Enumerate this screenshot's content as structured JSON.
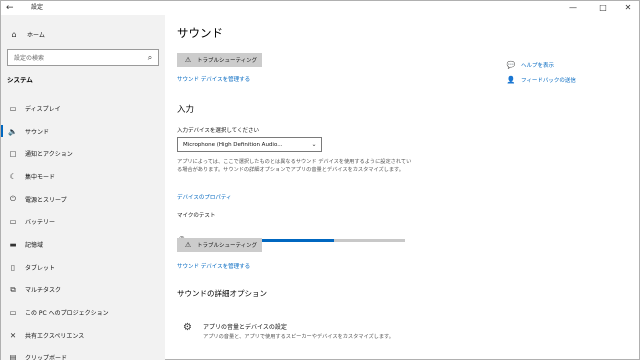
{
  "window": {
    "title": "設定",
    "back_icon": "back-arrow-icon",
    "controls": [
      "—",
      "□",
      "✕"
    ]
  },
  "sidebar": {
    "home_label": "ホーム",
    "search_placeholder": "設定の検索",
    "section": "システム",
    "items": [
      {
        "label": "ディスプレイ",
        "icon": "display-icon",
        "glyph": "▭"
      },
      {
        "label": "サウンド",
        "icon": "speaker-icon",
        "glyph": "🔈",
        "active": true
      },
      {
        "label": "通知とアクション",
        "icon": "notification-icon",
        "glyph": "▢"
      },
      {
        "label": "集中モード",
        "icon": "moon-icon",
        "glyph": "☾"
      },
      {
        "label": "電源とスリープ",
        "icon": "power-icon",
        "glyph": "⏻"
      },
      {
        "label": "バッテリー",
        "icon": "battery-icon",
        "glyph": "▭"
      },
      {
        "label": "記憶域",
        "icon": "storage-icon",
        "glyph": "▬"
      },
      {
        "label": "タブレット",
        "icon": "tablet-icon",
        "glyph": "▯"
      },
      {
        "label": "マルチタスク",
        "icon": "multitask-icon",
        "glyph": "⧉"
      },
      {
        "label": "この PC へのプロジェクション",
        "icon": "projection-icon",
        "glyph": "▭"
      },
      {
        "label": "共有エクスペリエンス",
        "icon": "shared-experiences-icon",
        "glyph": "✕"
      },
      {
        "label": "クリップボード",
        "icon": "clipboard-icon",
        "glyph": "▤"
      }
    ]
  },
  "main": {
    "title": "サウンド",
    "troubleshoot_label": "トラブルシューティング",
    "manage_devices_link": "サウンド デバイスを管理する",
    "input_heading": "入力",
    "input_device_label": "入力デバイスを選択してください",
    "input_device_value": "Microphone (High Definition Audio...",
    "description": "アプリによっては、ここで選択したものとは異なるサウンド デバイスを使用するように設定されている場合があります。サウンドの詳細オプションでアプリの音量とデバイスをカスタマイズします。",
    "device_properties_link": "デバイスのプロパティ",
    "mic_test_label": "マイクのテスト",
    "mic_level": 0.67,
    "troubleshoot_label_2": "トラブルシューティング",
    "manage_devices_link_2": "サウンド デバイスを管理する",
    "advanced_heading": "サウンドの詳細オプション",
    "advanced_item_title": "アプリの音量とデバイスの設定",
    "advanced_item_sub": "アプリの音量と、アプリで使用するスピーカーやデバイスをカスタマイズします。"
  },
  "side_links": [
    {
      "label": "ヘルプを表示",
      "icon": "help-icon",
      "glyph": "💬"
    },
    {
      "label": "フィードバックの送信",
      "icon": "feedback-icon",
      "glyph": "👤"
    }
  ],
  "colors": {
    "accent": "#0067c0",
    "sidebar_bg": "#f2f2f2",
    "button_bg": "#cccccc"
  }
}
